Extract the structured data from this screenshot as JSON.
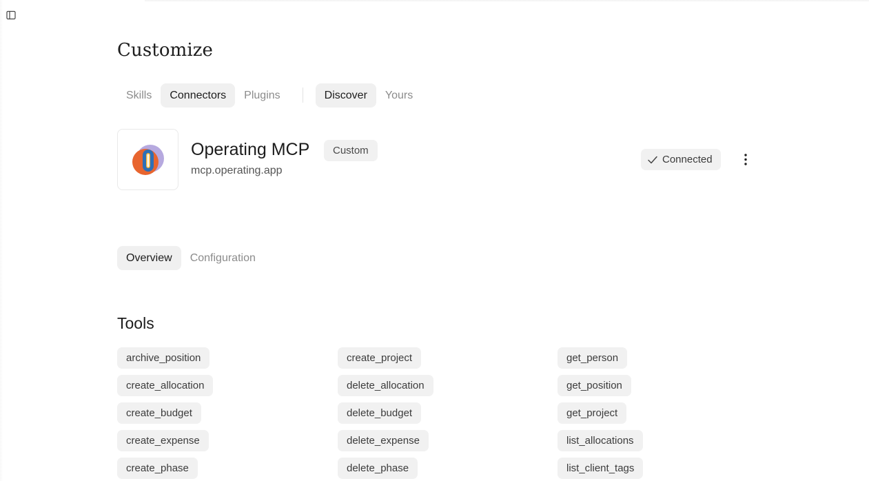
{
  "page": {
    "title": "Customize"
  },
  "sidebar_toggle": {
    "icon": "sidebar-panel-icon"
  },
  "category_tabs": [
    {
      "label": "Skills",
      "active": false
    },
    {
      "label": "Connectors",
      "active": true
    },
    {
      "label": "Plugins",
      "active": false
    }
  ],
  "scope_tabs": [
    {
      "label": "Discover",
      "active": true
    },
    {
      "label": "Yours",
      "active": false
    }
  ],
  "connector": {
    "name": "Operating MCP",
    "badge": "Custom",
    "url": "mcp.operating.app",
    "status": "Connected",
    "status_icon": "check-icon",
    "menu_icon": "more-vertical-icon",
    "logo_colors": [
      "#e8652f",
      "#2e6fb7",
      "#9b8fd3",
      "#f5b43a"
    ]
  },
  "detail_tabs": [
    {
      "label": "Overview",
      "active": true
    },
    {
      "label": "Configuration",
      "active": false
    }
  ],
  "tools": {
    "heading": "Tools",
    "columns": [
      [
        "archive_position",
        "create_allocation",
        "create_budget",
        "create_expense",
        "create_phase"
      ],
      [
        "create_project",
        "delete_allocation",
        "delete_budget",
        "delete_expense",
        "delete_phase"
      ],
      [
        "get_person",
        "get_position",
        "get_project",
        "list_allocations",
        "list_client_tags"
      ]
    ]
  }
}
